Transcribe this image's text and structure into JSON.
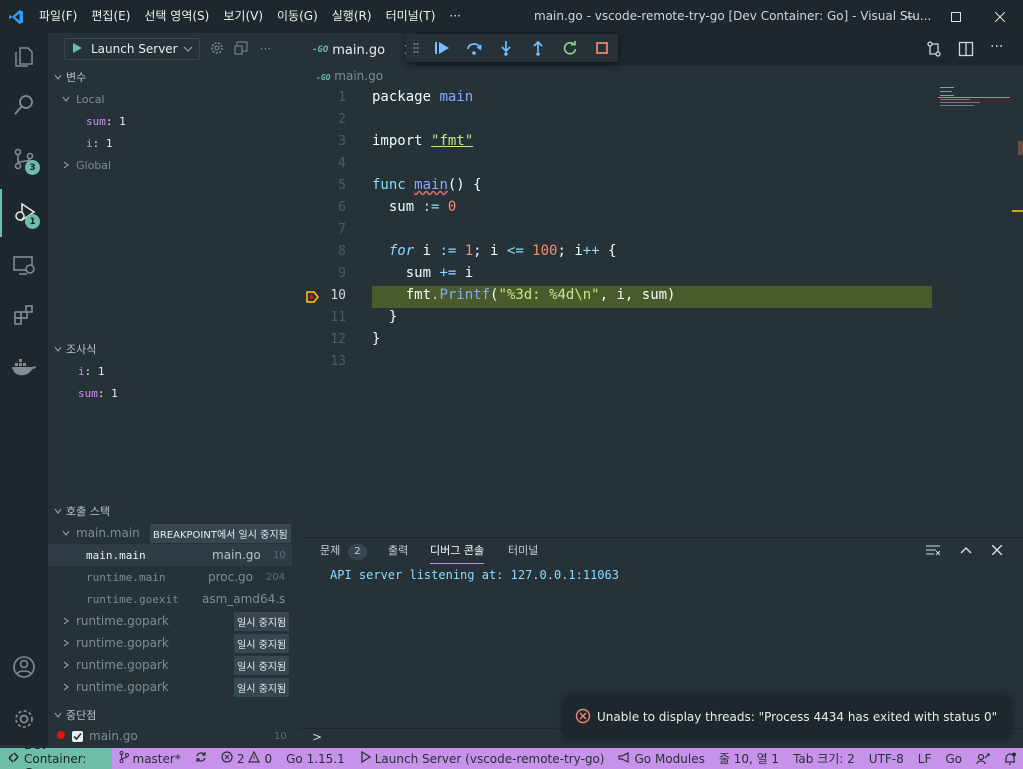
{
  "app": {
    "menu": [
      "파일(F)",
      "편집(E)",
      "선택 영역(S)",
      "보기(V)",
      "이동(G)",
      "실행(R)",
      "터미널(T)",
      "···"
    ],
    "title": "main.go - vscode-remote-try-go [Dev Container: Go] - Visual Stu..."
  },
  "activity": {
    "scm_badge": "3",
    "debug_badge": "1"
  },
  "debug": {
    "config": "Launch Server"
  },
  "variables": {
    "header": "변수",
    "local_label": "Local",
    "global_label": "Global",
    "locals": [
      {
        "name": "sum",
        "value": "1"
      },
      {
        "name": "i",
        "value": "1"
      }
    ]
  },
  "watch": {
    "header": "조사식",
    "items": [
      {
        "name": "i",
        "value": "1"
      },
      {
        "name": "sum",
        "value": "1"
      }
    ]
  },
  "callstack": {
    "header": "호출 스택",
    "thread": "main.main",
    "thread_status": "BREAKPOINT에서 일시 중지됨",
    "frames": [
      {
        "name": "main.main",
        "file": "main.go",
        "line": "10"
      },
      {
        "name": "runtime.main",
        "file": "proc.go",
        "line": "204"
      },
      {
        "name": "runtime.goexit",
        "file": "asm_amd64.s",
        "line": ""
      }
    ],
    "others": [
      {
        "name": "runtime.gopark",
        "status": "일시 중지됨"
      },
      {
        "name": "runtime.gopark",
        "status": "일시 중지됨"
      },
      {
        "name": "runtime.gopark",
        "status": "일시 중지됨"
      },
      {
        "name": "runtime.gopark",
        "status": "일시 중지됨"
      }
    ]
  },
  "breakpoints": {
    "header": "중단점",
    "items": [
      {
        "file": "main.go",
        "line": "10"
      }
    ]
  },
  "editor": {
    "tab": "main.go",
    "breadcrumb": "main.go",
    "line_numbers": [
      "1",
      "2",
      "3",
      "4",
      "5",
      "6",
      "7",
      "8",
      "9",
      "10",
      "11",
      "12",
      "13"
    ],
    "lines": {
      "l1a": "package ",
      "l1b": "main",
      "l3a": "import ",
      "l3b": "\"fmt\"",
      "l5a": "func ",
      "l5b": "main",
      "l5c": "() {",
      "l6a": "  sum ",
      "l6b": ":=",
      "l6c": " 0",
      "l8a": "  for",
      "l8b": " i ",
      "l8c": ":=",
      "l8d": " 1",
      "l8e": "; i ",
      "l8f": "<=",
      "l8g": " 100",
      "l8h": "; i",
      "l8i": "++",
      "l8j": " {",
      "l9a": "    sum ",
      "l9b": "+=",
      "l9c": " i",
      "l10a": "    fmt",
      "l10b": ".",
      "l10c": "Printf",
      "l10d": "(",
      "l10e": "\"%3d: %4d\\n\"",
      "l10f": ", i, sum)",
      "l11": "  }",
      "l12": "}"
    }
  },
  "panel": {
    "tabs": [
      "문제",
      "출력",
      "디버그 콘솔",
      "터미널"
    ],
    "problems_count": "2",
    "output": "API server listening at: 127.0.0.1:11063",
    "prompt": ">"
  },
  "notification": {
    "text": "Unable to display threads: \"Process 4434 has exited with status 0\""
  },
  "statusbar": {
    "remote": "Dev Container: Go",
    "branch": "master*",
    "errors": "2",
    "warnings": "0",
    "go_version": "Go 1.15.1",
    "launch": "Launch Server (vscode-remote-try-go)",
    "modules": "Go Modules",
    "position": "줄 10, 열 1",
    "tab_size": "Tab 크기: 2",
    "encoding": "UTF-8",
    "eol": "LF",
    "language": "Go"
  },
  "colors": {
    "accent": "#c792ea",
    "remote": "#6fbca8",
    "highlight": "#4a5a2a"
  }
}
